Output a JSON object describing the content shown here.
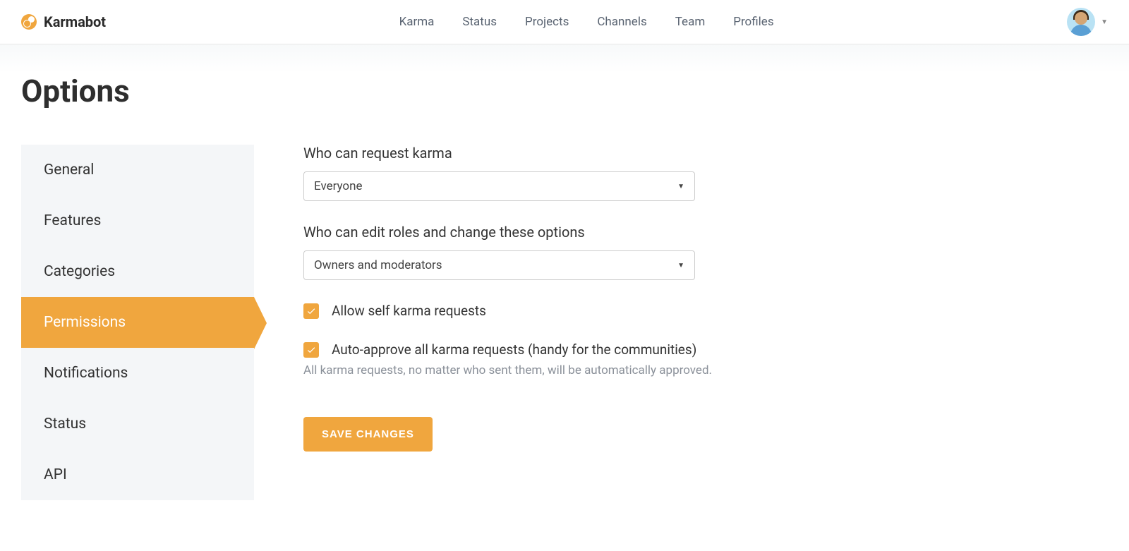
{
  "brand": {
    "name": "Karmabot"
  },
  "topnav": {
    "items": [
      "Karma",
      "Status",
      "Projects",
      "Channels",
      "Team",
      "Profiles"
    ]
  },
  "page": {
    "title": "Options"
  },
  "sidebar": {
    "items": [
      "General",
      "Features",
      "Categories",
      "Permissions",
      "Notifications",
      "Status",
      "API"
    ],
    "activeIndex": 3
  },
  "form": {
    "field1": {
      "label": "Who can request karma",
      "value": "Everyone"
    },
    "field2": {
      "label": "Who can edit roles and change these options",
      "value": "Owners and moderators"
    },
    "check1": {
      "label": "Allow self karma requests",
      "checked": true
    },
    "check2": {
      "label": "Auto-approve all karma requests (handy for the communities)",
      "helper": "All karma requests, no matter who sent them, will be automatically approved.",
      "checked": true
    },
    "saveLabel": "SAVE CHANGES"
  }
}
